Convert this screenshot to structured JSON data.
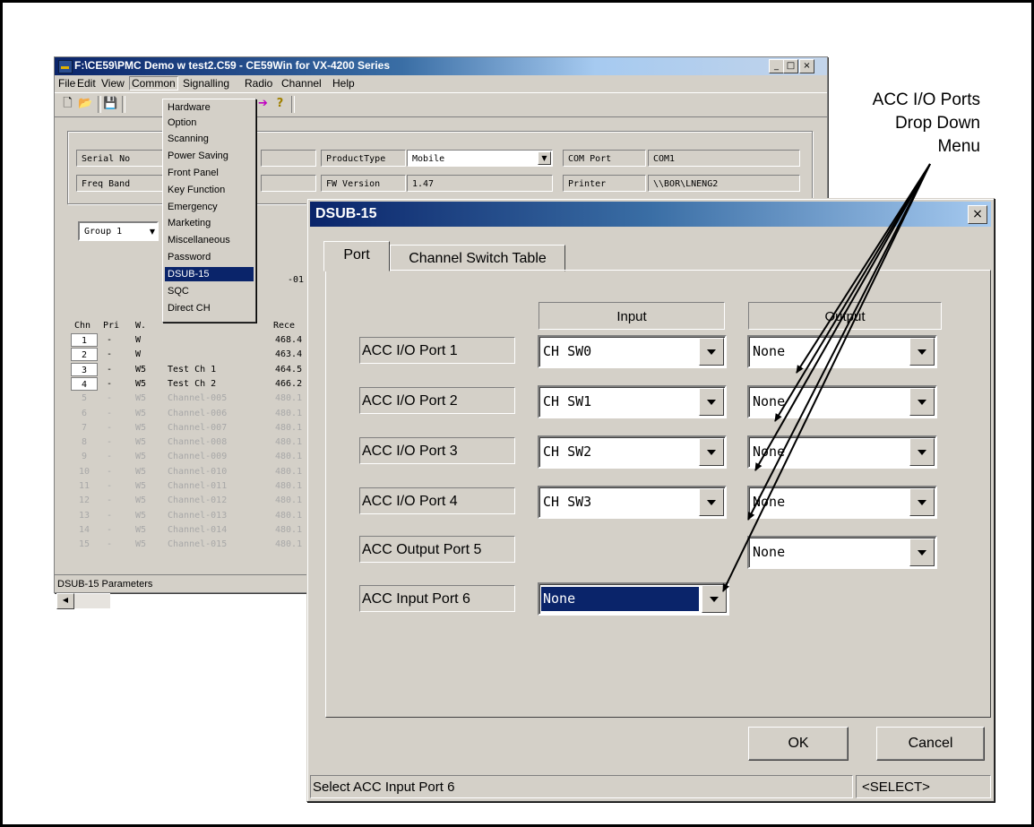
{
  "app": {
    "title": "F:\\CE59\\PMC Demo w test2.C59 - CE59Win for VX-4200 Series",
    "window_buttons": [
      "_",
      "□",
      "×"
    ],
    "menu": [
      "File",
      "Edit",
      "View",
      "Common",
      "Signalling",
      "Radio",
      "Channel",
      "Help"
    ],
    "info": {
      "serial_label": "Serial No",
      "freq_label": "Freq Band",
      "product_type_label": "ProductType",
      "product_type_value": "Mobile",
      "fw_label": "FW Version",
      "fw_value": "1.47",
      "com_label": "COM Port",
      "com_value": "COM1",
      "printer_label": "Printer",
      "printer_value": "\\\\BOR\\LNENG2"
    },
    "group_value": "Group 1",
    "group_code": "-01 ]",
    "grid_headers": [
      "Chn",
      "Pri",
      "W.",
      "Rece"
    ],
    "rows": [
      {
        "chn": "1",
        "pri": "-",
        "w": "W",
        "name": "",
        "rx": "468.4"
      },
      {
        "chn": "2",
        "pri": "-",
        "w": "W",
        "name": "",
        "rx": "463.4"
      },
      {
        "chn": "3",
        "pri": "-",
        "w": "W5",
        "name": "Test Ch 1",
        "rx": "464.5"
      },
      {
        "chn": "4",
        "pri": "-",
        "w": "W5",
        "name": "Test Ch 2",
        "rx": "466.2"
      },
      {
        "chn": "5",
        "pri": "-",
        "w": "W5",
        "name": "Channel-005",
        "rx": "480.1"
      },
      {
        "chn": "6",
        "pri": "-",
        "w": "W5",
        "name": "Channel-006",
        "rx": "480.1"
      },
      {
        "chn": "7",
        "pri": "-",
        "w": "W5",
        "name": "Channel-007",
        "rx": "480.1"
      },
      {
        "chn": "8",
        "pri": "-",
        "w": "W5",
        "name": "Channel-008",
        "rx": "480.1"
      },
      {
        "chn": "9",
        "pri": "-",
        "w": "W5",
        "name": "Channel-009",
        "rx": "480.1"
      },
      {
        "chn": "10",
        "pri": "-",
        "w": "W5",
        "name": "Channel-010",
        "rx": "480.1"
      },
      {
        "chn": "11",
        "pri": "-",
        "w": "W5",
        "name": "Channel-011",
        "rx": "480.1"
      },
      {
        "chn": "12",
        "pri": "-",
        "w": "W5",
        "name": "Channel-012",
        "rx": "480.1"
      },
      {
        "chn": "13",
        "pri": "-",
        "w": "W5",
        "name": "Channel-013",
        "rx": "480.1"
      },
      {
        "chn": "14",
        "pri": "-",
        "w": "W5",
        "name": "Channel-014",
        "rx": "480.1"
      },
      {
        "chn": "15",
        "pri": "-",
        "w": "W5",
        "name": "Channel-015",
        "rx": "480.1"
      }
    ],
    "status": "DSUB-15 Parameters"
  },
  "common_menu": {
    "items": [
      "Hardware",
      "Option",
      "Scanning",
      "Power Saving",
      "Front Panel",
      "Key Function",
      "Emergency",
      "Marketing",
      "Miscellaneous",
      "Password",
      "DSUB-15",
      "SQC",
      "Direct CH"
    ],
    "selected": "DSUB-15"
  },
  "dialog": {
    "title": "DSUB-15",
    "close": "×",
    "tabs": [
      "Port",
      "Channel Switch Table"
    ],
    "input_header": "Input",
    "output_header": "Output",
    "ports": [
      {
        "label": "ACC I/O Port 1",
        "input": "CH SW0",
        "output": "None"
      },
      {
        "label": "ACC I/O Port 2",
        "input": "CH SW1",
        "output": "None"
      },
      {
        "label": "ACC I/O Port 3",
        "input": "CH SW2",
        "output": "None"
      },
      {
        "label": "ACC I/O Port 4",
        "input": "CH SW3",
        "output": "None"
      },
      {
        "label": "ACC Output Port 5",
        "output": "None"
      },
      {
        "label": "ACC Input Port 6",
        "input": "None"
      }
    ],
    "ok": "OK",
    "cancel": "Cancel",
    "status": "Select ACC Input Port 6",
    "status_right": "<SELECT>"
  },
  "callout": {
    "lines": [
      "ACC I/O Ports",
      "Drop Down",
      "Menu"
    ]
  }
}
